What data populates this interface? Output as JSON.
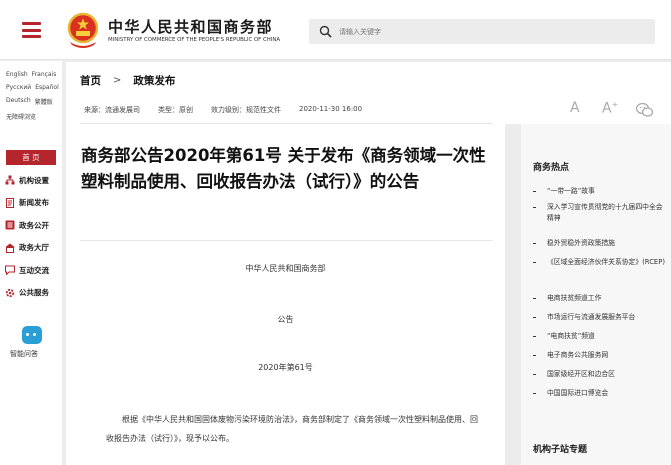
{
  "header": {
    "title": "中华人民共和国商务部",
    "subtitle": "MINISTRY OF COMMERCE OF THE PEOPLE'S REPUBLIC OF CHINA",
    "search_placeholder": "请输入关键字"
  },
  "languages": [
    [
      "English",
      "Français"
    ],
    [
      "Русский",
      "Español"
    ],
    [
      "Deutsch",
      "繁體版"
    ],
    [
      "无障碍浏览"
    ]
  ],
  "nav": {
    "home": "首 页",
    "items": [
      "机构设置",
      "新闻发布",
      "政务公开",
      "政务大厅",
      "互动交流",
      "公共服务"
    ],
    "smart_qa": "智能问答"
  },
  "breadcrumb": {
    "home": "首页",
    "separator": ">",
    "current": "政策发布"
  },
  "article": {
    "meta": [
      "来源：流通发展司",
      "类型：原创",
      "效力级别：规范性文件",
      "2020-11-30 16:00"
    ],
    "title": "商务部公告2020年第61号 关于发布《商务领域一次性塑料制品使用、回收报告办法（试行）》的公告",
    "issuer": "中华人民共和国商务部",
    "doc_type": "公告",
    "doc_number": "2020年第61号",
    "body": "根据《中华人民共和国固体废物污染环境防治法》，商务部制定了《商务领域一次性塑料制品使用、回收报告办法（试行）》，现予以公布。"
  },
  "tools": {
    "font_small": "A",
    "font_large": "A",
    "font_large_sup": "+"
  },
  "sidebar_right": {
    "hot_title": "商务热点",
    "hot_items": [
      "“一带一路”故事",
      "深入学习宣传贯彻党的十九届四中全会精神",
      "稳外贸稳外资政策措施",
      "《区域全面经济伙伴关系协定》(RCEP)",
      "电商扶贫频道工作",
      "市场运行与流通发展服务平台",
      "“电商扶贫”频道",
      "电子商务公共服务网",
      "国家级经开区和边合区",
      "中国国际进口博览会"
    ],
    "org_title": "机构子站专题"
  },
  "colors": {
    "brand_red": "#b4262c",
    "page_bg": "#ececec"
  }
}
